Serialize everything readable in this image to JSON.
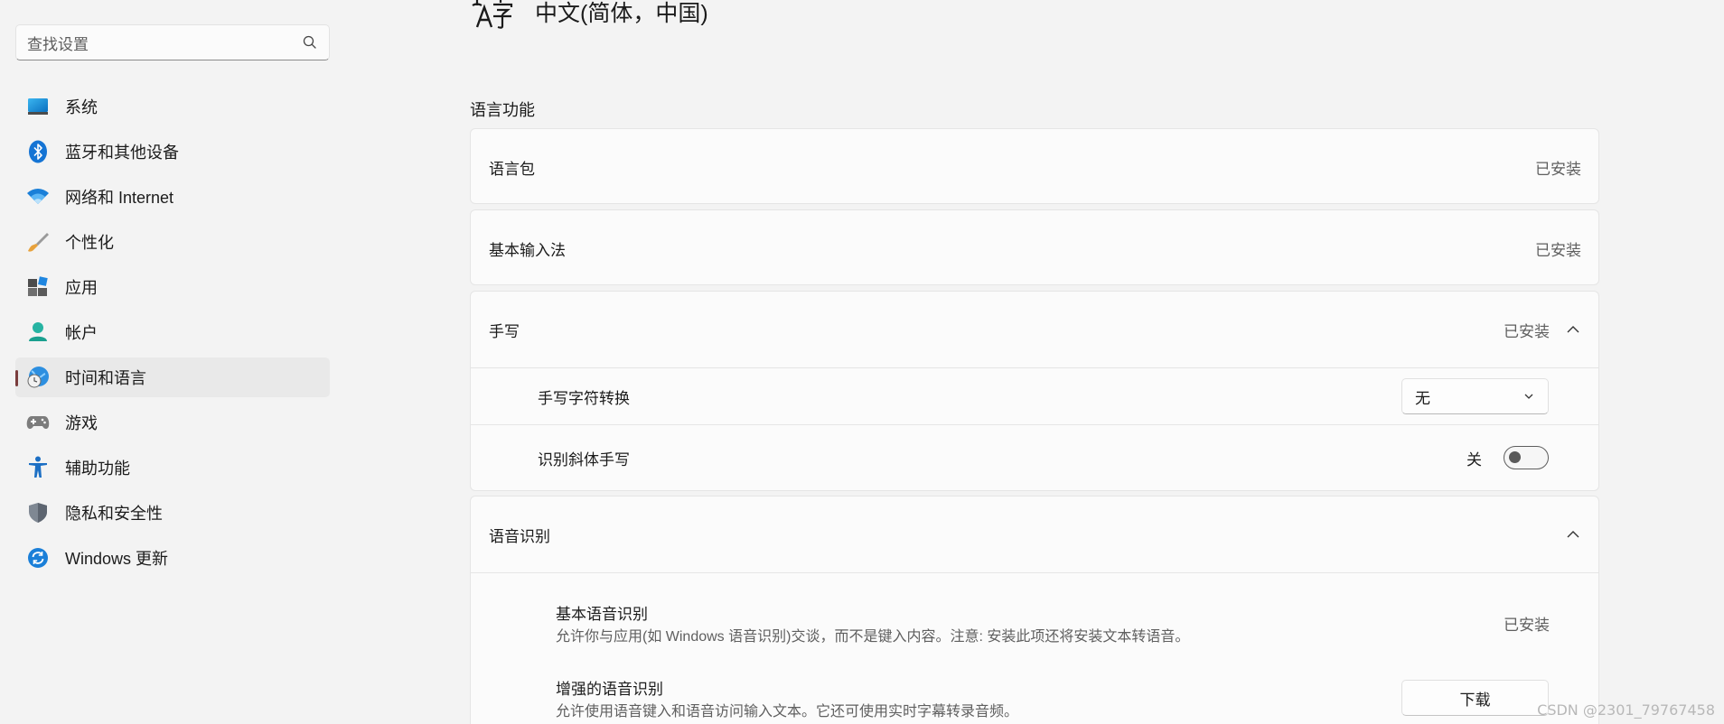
{
  "search": {
    "placeholder": "查找设置"
  },
  "sidebar": {
    "items": [
      {
        "label": "系统",
        "icon": "display-icon"
      },
      {
        "label": "蓝牙和其他设备",
        "icon": "bluetooth-icon"
      },
      {
        "label": "网络和 Internet",
        "icon": "wifi-icon"
      },
      {
        "label": "个性化",
        "icon": "brush-icon"
      },
      {
        "label": "应用",
        "icon": "apps-icon"
      },
      {
        "label": "帐户",
        "icon": "account-icon"
      },
      {
        "label": "时间和语言",
        "icon": "globe-clock-icon",
        "active": true
      },
      {
        "label": "游戏",
        "icon": "gamepad-icon"
      },
      {
        "label": "辅助功能",
        "icon": "accessibility-icon"
      },
      {
        "label": "隐私和安全性",
        "icon": "shield-icon"
      },
      {
        "label": "Windows 更新",
        "icon": "sync-icon"
      }
    ]
  },
  "header": {
    "title": "中文(简体，中国)",
    "icon": "language-icon"
  },
  "section": {
    "title": "语言功能"
  },
  "features": {
    "language_pack": {
      "label": "语言包",
      "status": "已安装"
    },
    "basic_typing": {
      "label": "基本输入法",
      "status": "已安装"
    },
    "handwriting": {
      "label": "手写",
      "status": "已安装",
      "char_conversion": {
        "label": "手写字符转换",
        "value": "无"
      },
      "italic": {
        "label": "识别斜体手写",
        "state": "关"
      }
    },
    "speech": {
      "label": "语音识别",
      "basic": {
        "title": "基本语音识别",
        "desc": "允许你与应用(如 Windows 语音识别)交谈，而不是键入内容。注意: 安装此项还将安装文本转语音。",
        "status": "已安装"
      },
      "enhanced": {
        "title": "增强的语音识别",
        "desc": "允许使用语音键入和语音访问输入文本。它还可使用实时字幕转录音频。",
        "button": "下载"
      }
    }
  },
  "watermark": "CSDN @2301_79767458",
  "colors": {
    "accent": "#0067c0",
    "active_indicator": "#7a3d3d",
    "background": "#f3f3f3"
  }
}
